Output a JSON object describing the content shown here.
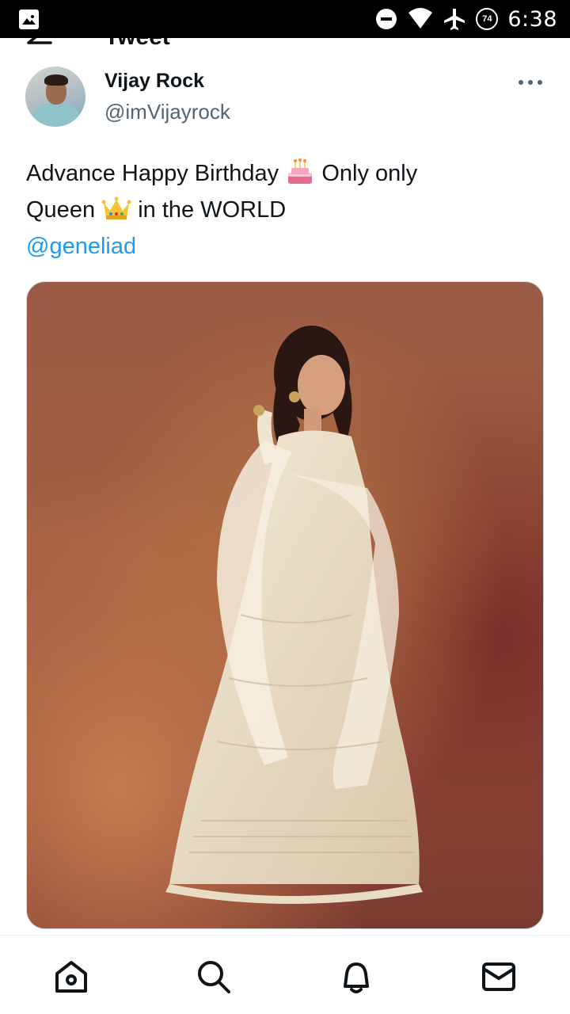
{
  "status_bar": {
    "time": "6:38",
    "battery": "74"
  },
  "header": {
    "title": "Tweet"
  },
  "tweet": {
    "author_name": "Vijay Rock",
    "author_handle": "@imVijayrock",
    "text_part1": "Advance Happy Birthday",
    "text_part2": "Only only",
    "text_part3": "Queen",
    "text_part4": "in the WORLD",
    "mention": "@geneliad",
    "emoji_1": "birthday-cake",
    "emoji_2": "crown"
  },
  "media": {
    "description_icon": "photo"
  },
  "nav": {
    "items": [
      "home-icon",
      "search-icon",
      "notifications-icon",
      "messages-icon"
    ]
  },
  "colors": {
    "link": "#1d9bf0",
    "text": "#0f1419",
    "secondary": "#536471"
  }
}
